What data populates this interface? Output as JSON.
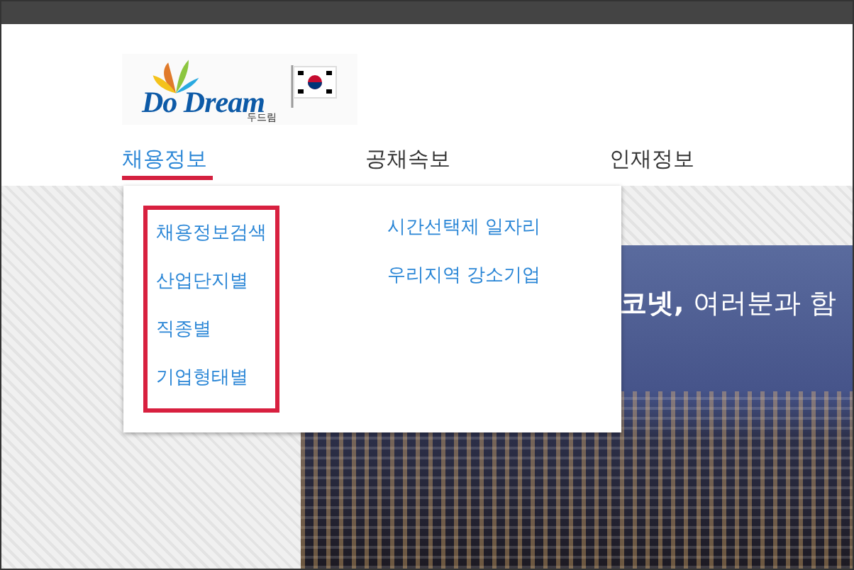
{
  "logo": {
    "wordmark": "Do Dream",
    "subtitle": "두드림"
  },
  "nav": [
    {
      "label": "채용정보",
      "selected": true
    },
    {
      "label": "공채속보",
      "selected": false
    },
    {
      "label": "인재정보",
      "selected": false
    }
  ],
  "dropdown": {
    "columns": [
      {
        "highlighted": true,
        "items": [
          "채용정보검색",
          "산업단지별",
          "직종별",
          "기업형태별"
        ]
      },
      {
        "highlighted": false,
        "items": [
          "시간선택제 일자리",
          "우리지역 강소기업"
        ]
      }
    ]
  },
  "banner": {
    "bold_text": "코넷,",
    "text": "여러분과 함"
  }
}
